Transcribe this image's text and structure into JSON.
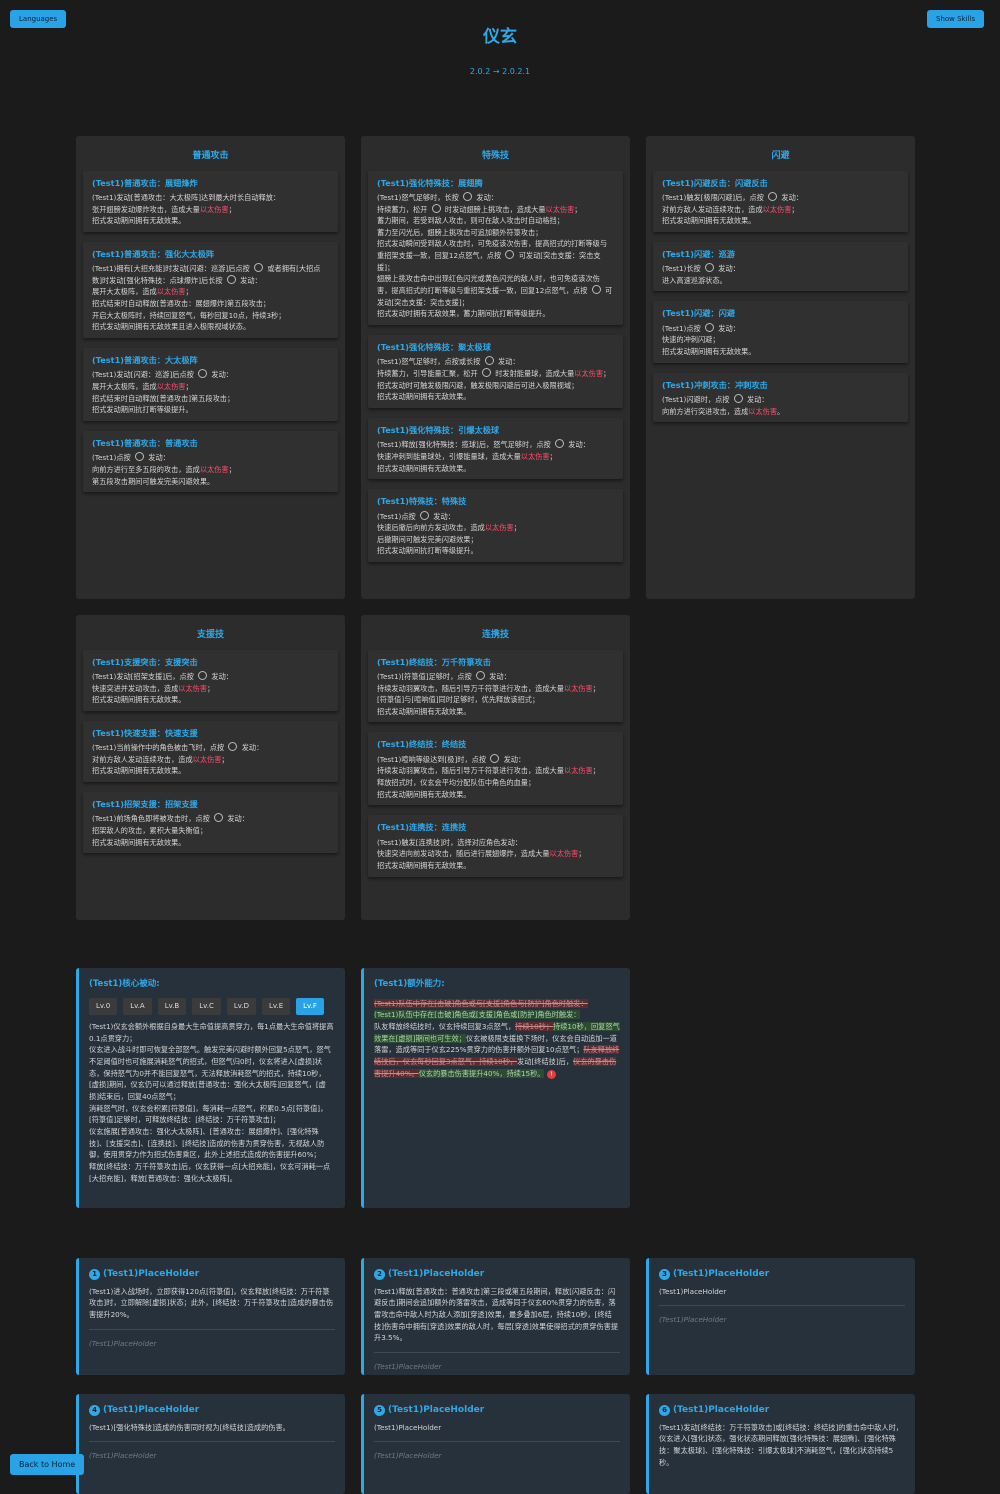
{
  "header": {
    "languages": "Languages",
    "show_skills": "Show Skills",
    "title": "仪玄",
    "version": "2.0.2 → 2.0.2.1",
    "back_home": "Back to Home"
  },
  "panels": {
    "basic": {
      "title": "普通攻击",
      "skills": [
        {
          "name": "(Test1)普通攻击：展翅烽炸",
          "desc": "(Test1)发动[普通攻击：大太极阵]达到最大时长自动释放：\n张开翅膀发动爆炸攻击，造成大量|以太伤害|；\n招式发动期间拥有无敌效果。"
        },
        {
          "name": "(Test1)普通攻击：强化大太极阵",
          "desc": "(Test1)拥有[大招充能]时发动[闪避：巡游]后点按 ◎ 或者拥有[大招点数]时发动[强化特殊技：点球爆炸]后长按 ◎ 发动：\n展开大太极阵，造成|以太伤害|；\n招式结束时自动释放[普通攻击：展翅爆炸]第五段攻击；\n开启大太极阵时，持续回复怒气，每秒回复10点，持续3秒；\n招式发动期间拥有无敌效果且进入极限视域状态。"
        },
        {
          "name": "(Test1)普通攻击：大太极阵",
          "desc": "(Test1)发动[闪避：巡游]后点按 ◎ 发动：\n展开大太极阵，造成|以太伤害|；\n招式结束时自动释放[普通攻击]第五段攻击；\n招式发动期间抗打断等级提升。"
        },
        {
          "name": "(Test1)普通攻击：普通攻击",
          "desc": "(Test1)点按 ◎ 发动：\n向前方进行至多五段的攻击，造成|以太伤害|；\n第五段攻击期间可触发完美闪避效果。"
        }
      ]
    },
    "special": {
      "title": "特殊技",
      "skills": [
        {
          "name": "(Test1)强化特殊技：展翅腾",
          "desc": "(Test1)怒气足够时，长按 ◎ 发动：\n持续蓄力，松开 ◎ 时发动翅膀上挑攻击，造成大量|以太伤害|；\n蓄力期间，若受到敌人攻击，则可在敌人攻击时自动格挡；\n蓄力至闪光后，翅膀上挑攻击可追加额外符箓攻击；\n招式发动瞬间受到敌人攻击时，可免疫该次伤害，提高招式的打断等级与重招架支援一致，回复12点怒气，点按 ◎ 可发动[突击支援：突击支援]；\n翅膀上挑攻击命中出现红色闪光或黄色闪光的敌人时，也可免疫该次伤害，提高招式的打断等级与重招架支援一致，回复12点怒气，点按 ◎ 可发动[突击支援：突击支援]；\n招式发动时拥有无敌效果，蓄力期间抗打断等级提升。"
        },
        {
          "name": "(Test1)强化特殊技：聚太极球",
          "desc": "(Test1)怒气足够时，点按或长按 ◎ 发动：\n持续蓄力，引导能量汇聚，松开 ◎ 时发射能量球，造成大量|以太伤害|；\n招式发动时可触发极限闪避，触发极限闪避后可进入极限视域；\n招式发动期间拥有无敌效果。"
        },
        {
          "name": "(Test1)强化特殊技：引爆太极球",
          "desc": "(Test1)释放[强化特殊技：揽球]后，怒气足够时，点按 ◎ 发动：\n快速冲刺到能量球处，引爆能量球，造成大量|以太伤害|；\n招式发动期间拥有无敌效果。"
        },
        {
          "name": "(Test1)特殊技：特殊技",
          "desc": "(Test1)点按 ◎ 发动：\n快速后撤后向前方发动攻击，造成|以太伤害|；\n后撤期间可触发完美闪避效果；\n招式发动期间抗打断等级提升。"
        }
      ]
    },
    "dodge": {
      "title": "闪避",
      "skills": [
        {
          "name": "(Test1)闪避反击：闪避反击",
          "desc": "(Test1)触发[极限闪避]后，点按 ◎ 发动：\n对前方敌人发动连续攻击，造成|以太伤害|；\n招式发动期间拥有无敌效果。"
        },
        {
          "name": "(Test1)闪避：巡游",
          "desc": "(Test1)长按 ◎ 发动：\n进入高速巡游状态。"
        },
        {
          "name": "(Test1)闪避：闪避",
          "desc": "(Test1)点按 ◎ 发动：\n快速的冲刺闪避；\n招式发动期间拥有无敌效果。"
        },
        {
          "name": "(Test1)冲刺攻击：冲刺攻击",
          "desc": "(Test1)闪避时，点按 ◎ 发动：\n向前方进行突进攻击，造成|以太伤害|。"
        }
      ]
    },
    "assist": {
      "title": "支援技",
      "skills": [
        {
          "name": "(Test1)支援突击：支援突击",
          "desc": "(Test1)发动[招架支援]后，点按 ◎ 发动：\n快速突进并发动攻击，造成|以太伤害|；\n招式发动期间拥有无敌效果。"
        },
        {
          "name": "(Test1)快速支援：快速支援",
          "desc": "(Test1)当前操作中的角色被击飞时，点按 ◎ 发动：\n对前方敌人发动连续攻击，造成|以太伤害|；\n招式发动期间拥有无敌效果。"
        },
        {
          "name": "(Test1)招架支援：招架支援",
          "desc": "(Test1)前场角色即将被攻击时，点按 ◎ 发动：\n招架敌人的攻击，累积大量失衡值；\n招式发动期间拥有无敌效果。"
        }
      ]
    },
    "chain": {
      "title": "连携技",
      "skills": [
        {
          "name": "(Test1)终结技：万千符箓攻击",
          "desc": "(Test1)[符箓值]足够时，点按 ◎ 发动：\n持续发动羽翼攻击，随后引导万千符箓进行攻击，造成大量|以太伤害|；\n[符箓值]与[喧响值]同时足够时，优先释放该招式；\n招式发动期间拥有无敌效果。"
        },
        {
          "name": "(Test1)终结技：终结技",
          "desc": "(Test1)喧响等级达到[极]时，点按 ◎ 发动：\n持续发动羽翼攻击，随后引导万千符箓进行攻击，造成大量|以太伤害|；\n释放招式时，仪玄会平均分配队伍中角色的血量；\n招式发动期间拥有无敌效果。"
        },
        {
          "name": "(Test1)连携技：连携技",
          "desc": "(Test1)触发[连携技]时，选择对应角色发动：\n快速突进向前发动攻击，随后进行展翅爆炸，造成大量|以太伤害|；\n招式发动期间拥有无敌效果。"
        }
      ]
    }
  },
  "core": {
    "title": "(Test1)核心被动:",
    "tabs": [
      "Lv.0",
      "Lv.A",
      "Lv.B",
      "Lv.C",
      "Lv.D",
      "Lv.E",
      "Lv.F"
    ],
    "active_tab": "Lv.F",
    "desc": "(Test1)仪玄会额外根据自身最大生命值提高贯穿力，每1点最大生命值将提高0.1点贯穿力；\n仪玄进入战斗时即可恢复全部怒气。触发完美闪避时额外回复5点怒气，怒气不足阈值时也可施展消耗怒气的招式，但怒气归0时，仪玄将进入[虚损]状态，保持怒气为0并不能回复怒气，无法释放消耗怒气的招式，持续10秒，[虚损]期间，仪玄仍可以通过释放[普通攻击：强化大太极阵]回复怒气，[虚损]结束后，回复40点怒气；\n消耗怒气时，仪玄会积累[符箓值]，每消耗一点怒气，积累0.5点[符箓值]，[符箓值]足够时，可释放终结技：[终结技：万千符箓攻击]；\n仪玄施展[普通攻击：强化大太极阵]、[普通攻击：展翅爆炸]、[强化特殊技]、[支援突击]、[连携技]、[终结技]造成的伤害为贯穿伤害，无视敌人防御，使用贯穿力作为招式伤害乘区，此外上述招式造成的伤害提升60%；\n释放[终结技：万千符箓攻击]后，仪玄获得一点[大招充能]，仪玄可消耗一点[大招充能]，释放[普通攻击：强化大太极阵]。"
  },
  "extra": {
    "title": "(Test1)额外能力:",
    "line_old": "(Test1)队伍中存在[击破]角色或与[支援]角色与[防护]角色时触发：",
    "line_new": "(Test1)队伍中存在[击破]角色或[支援]角色或[防护]角色时触发：",
    "p1": "队友释放终结技时，仪玄持续回复3点怒气，",
    "p1_del": "持续10秒；",
    "p1_add": "持续10秒，回复怒气效果在[虚损]期间也可生效；",
    "p2": "仪玄被极限支援换下场时，仪玄会自动追加一道落雷，造成等同于仪玄225%贯穿力的伤害并额外回复10点怒气；",
    "p3_del": "队友释放终结技后，仪玄每秒回复3点怒气，持续10秒，",
    "p4": "发动[终结技]后，",
    "p4_del": "仪玄的暴击伤害提升40%。",
    "p4_add": "仪玄的暴击伤害提升40%，持续15秒。",
    "info_icon": "!"
  },
  "placeholders": [
    {
      "num": "1",
      "title": "(Test1)PlaceHolder",
      "body": "(Test1)进入战场时，立即获得120点[符箓值]，仪玄释放[终结技：万千符箓攻击]时，立即解除[虚损]状态；此外，[终结技：万千符箓攻击]造成的暴击伤害提升20%。",
      "foot": "(Test1)PlaceHolder"
    },
    {
      "num": "2",
      "title": "(Test1)PlaceHolder",
      "body": "(Test1)释放[普通攻击：普通攻击]第三段或第五段期间，释放[闪避反击：闪避反击]期间会追加额外的落雷攻击，造成等同于仪玄60%贯穿力的伤害，落雷攻击命中敌人时为敌人添加[穿透]效果，最多叠加6层，持续10秒，[终结技]伤害命中拥有[穿透]效果的敌人时，每层[穿透]效果使得招式的贯穿伤害提升3.5%。",
      "foot": "(Test1)PlaceHolder"
    },
    {
      "num": "3",
      "title": "(Test1)PlaceHolder",
      "body": "(Test1)PlaceHolder",
      "foot": "(Test1)PlaceHolder"
    },
    {
      "num": "4",
      "title": "(Test1)PlaceHolder",
      "body": "(Test1)[强化特殊技]造成的伤害同时视为[终结技]造成的伤害。",
      "foot": "(Test1)PlaceHolder"
    },
    {
      "num": "5",
      "title": "(Test1)PlaceHolder",
      "body": "(Test1)PlaceHolder",
      "foot": "(Test1)PlaceHolder"
    },
    {
      "num": "6",
      "title": "(Test1)PlaceHolder",
      "body": "(Test1)发动[终结技：万千符箓攻击]或[终结技：终结技]的重击命中敌人时，仪玄进入[强化]状态，强化状态期间释放[强化特殊技：展翅腾]、[强化特殊技：聚太极球]、[强化特殊技：引爆太极球]不消耗怒气，[强化]状态持续5秒。",
      "foot": ""
    }
  ],
  "colors": {
    "accent": "#2fa8e8",
    "damage": "#ff4d6d",
    "background": "#1b1b1b",
    "panel": "#2c2c2c"
  }
}
